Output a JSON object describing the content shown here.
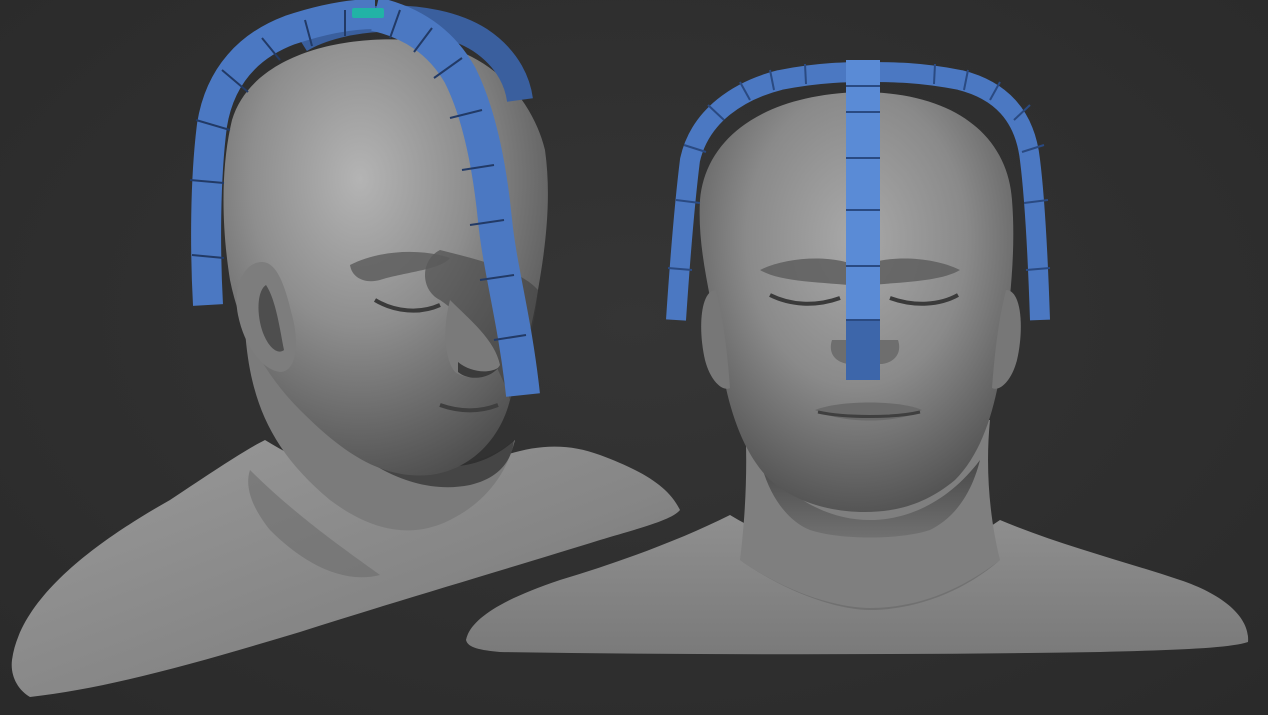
{
  "scene": {
    "background_color": "#2e2e2e",
    "mesh_color": "#8c8c8c",
    "guide_color": "#4b78c2",
    "guide_highlight_color": "#22b3a6"
  },
  "views": [
    {
      "name": "three-quarter-view",
      "guide_strips": 3,
      "selected_segment": true
    },
    {
      "name": "front-view",
      "guide_strips": 2,
      "selected_segment": false
    }
  ]
}
